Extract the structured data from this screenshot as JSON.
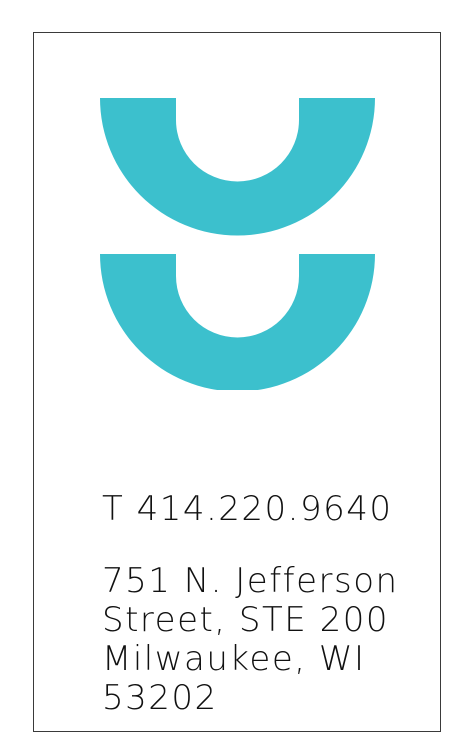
{
  "brand": {
    "logo_icon": "double-u-logo-icon",
    "accent_color": "#3cc0cd"
  },
  "contact": {
    "phone": "T 414.220.9640",
    "address_lines": [
      "751 N. Jefferson",
      "Street, STE 200",
      "Milwaukee, WI",
      "53202"
    ]
  }
}
